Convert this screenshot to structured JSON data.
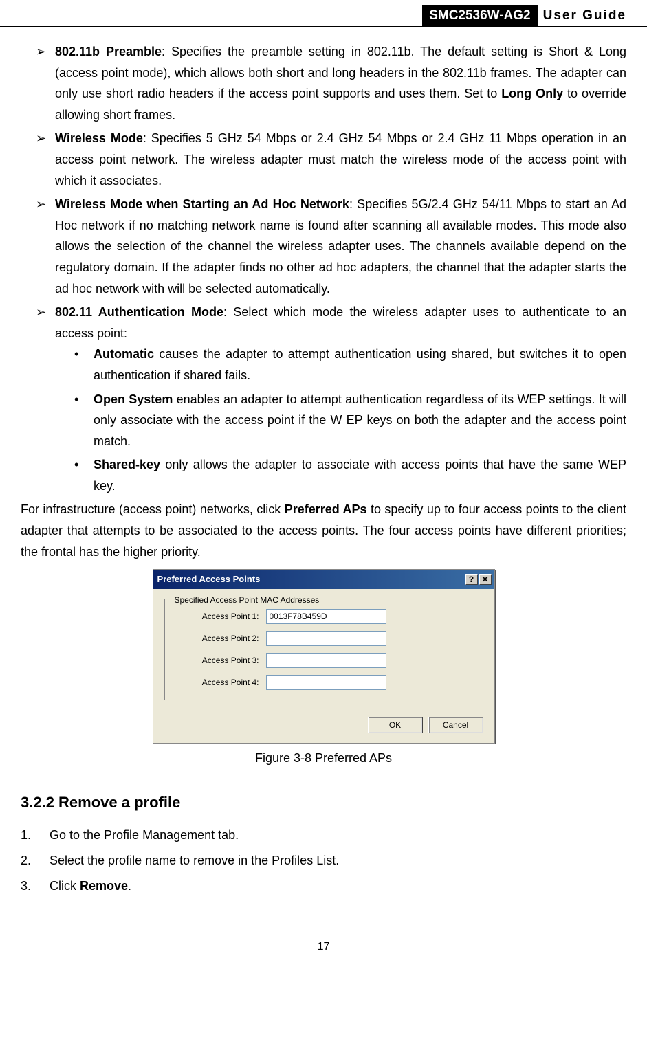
{
  "header": {
    "model": "SMC2536W-AG2",
    "guide": "User Guide"
  },
  "bullets": {
    "preamble_bold": "802.11b Preamble",
    "preamble_text1": ": Specifies the preamble setting in 802.11b.   The default setting is Short & Long (access point mode), which allows both short and long headers in the 802.11b frames. The adapter can only use short radio headers if the access point supports and uses them. Set to ",
    "preamble_bold2": "Long Only",
    "preamble_text2": " to override allowing short frames.",
    "wmode_bold": "Wireless Mode",
    "wmode_text": ": Specifies 5 GHz 54 Mbps or 2.4 GHz 54 Mbps or 2.4 GHz 11 Mbps operation in an access point network. The wireless adapter must match the wireless mode of the access point with which it associates.",
    "adhoc_bold": "Wireless Mode when Starting an Ad Hoc Network",
    "adhoc_text": ": Specifies 5G/2.4 GHz 54/11 Mbps to start an Ad Hoc network if no matching network name is found after scanning all available modes. This mode also allows the selection of the channel the wireless adapter uses.  The channels available depend on the regulatory domain. If the adapter finds no other ad hoc adapters, the channel that the adapter starts the ad hoc network with will be selected automatically.",
    "auth_bold": "802.11 Authentication Mode",
    "auth_text": ": Select which mode the wireless adapter uses to authenticate to an access point:",
    "auto_bold": "Automatic",
    "auto_text": " causes the adapter to attempt authentication using shared, but switches it to open authentication if shared fails.",
    "open_bold": "Open System",
    "open_text": " enables an adapter to attempt authentication regardless of its WEP settings. It will only associate with the access point if the W EP keys on both the adapter and the access point match.",
    "shared_bold": "Shared-key",
    "shared_text": " only allows the adapter to associate with access points that have the same WEP key."
  },
  "para": {
    "p1a": "For infrastructure (access point) networks, click ",
    "p1b": "Preferred APs",
    "p1c": " to specify up to four access points to the client adapter that attempts to be associated to the access points. The four access points have different priorities; the frontal has the higher priority."
  },
  "dialog": {
    "title": "Preferred Access Points",
    "help": "?",
    "close": "✕",
    "groupbox": "Specified Access Point MAC Addresses",
    "ap1_label": "Access Point 1:",
    "ap1_value": "0013F78B459D",
    "ap2_label": "Access Point 2:",
    "ap2_value": "",
    "ap3_label": "Access Point 3:",
    "ap3_value": "",
    "ap4_label": "Access Point 4:",
    "ap4_value": "",
    "ok": "OK",
    "cancel": "Cancel"
  },
  "figure_caption": "Figure 3-8 Preferred APs",
  "section": {
    "heading": "3.2.2  Remove a profile",
    "step1": "Go to the Profile Management tab.",
    "step2": "Select the profile name to remove in the Profiles List.",
    "step3a": "Click ",
    "step3b": "Remove",
    "step3c": "."
  },
  "page_number": "17"
}
